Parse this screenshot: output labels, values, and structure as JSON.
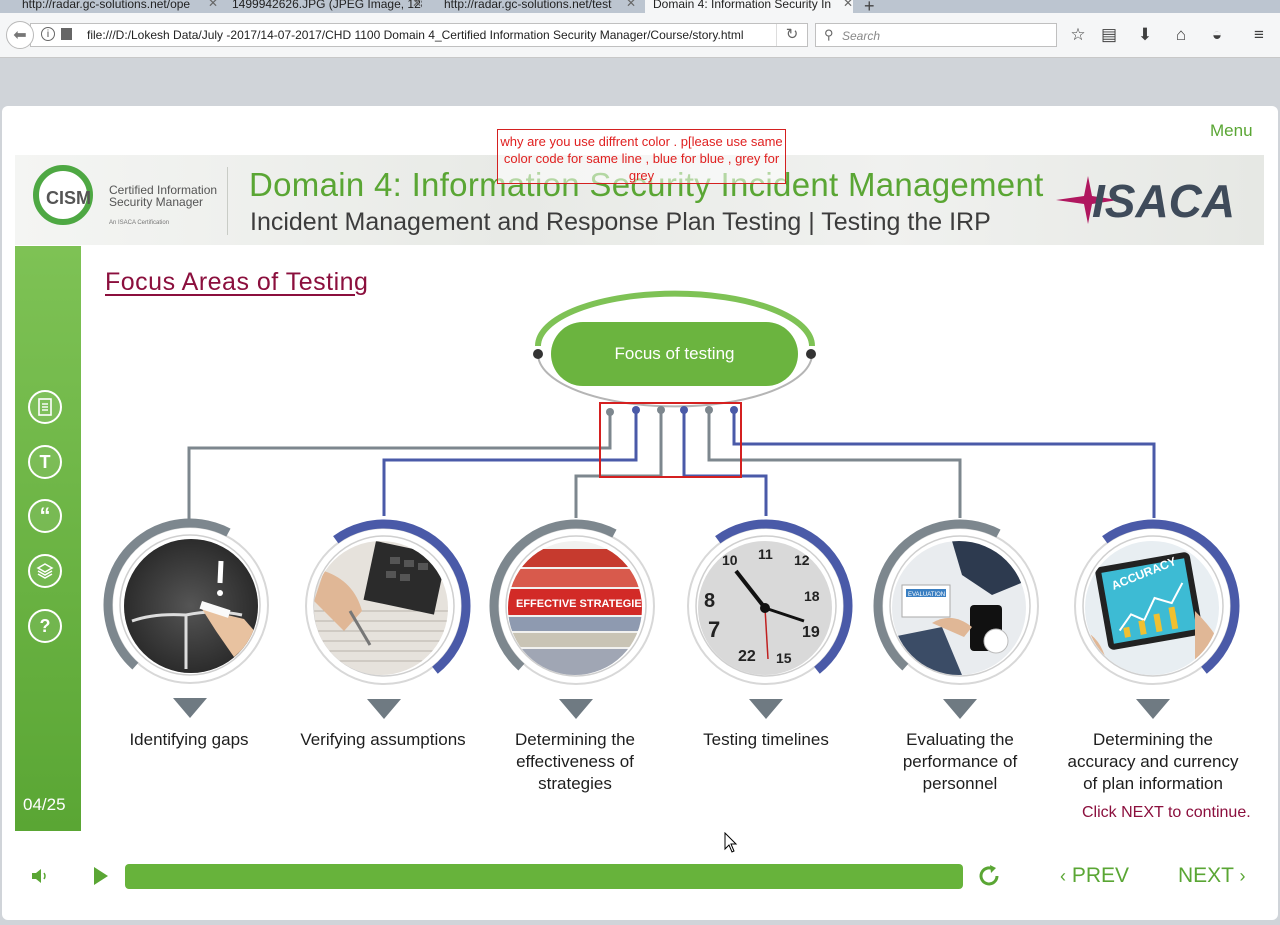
{
  "browser": {
    "tabs": [
      {
        "label": "http://radar.gc-solutions.net/ope",
        "active": false
      },
      {
        "label": "1499942626.JPG (JPEG Image, 128",
        "active": false
      },
      {
        "label": "http://radar.gc-solutions.net/test",
        "active": false
      },
      {
        "label": "Domain 4: Information Security In",
        "active": true
      }
    ],
    "url": "file:///D:/Lokesh Data/July -2017/14-07-2017/CHD 1100 Domain 4_Certified Information Security Manager/Course/story.html",
    "search_placeholder": "Search"
  },
  "course": {
    "menu_label": "Menu",
    "logo": {
      "acronym": "CISM",
      "line1": "Certified Information",
      "line2": "Security Manager",
      "tagline": "An ISACA Certification"
    },
    "partner_logo": "ISACA",
    "domain_title": "Domain 4: Information Security Incident Management",
    "subtitle": "Incident Management and Response Plan Testing | Testing the IRP",
    "review_note": "why are you use diffrent color . p[lease use same color code for same line , blue for blue , grey for grey",
    "heading": "Focus Areas of Testing",
    "center_label": "Focus of testing",
    "items": [
      {
        "label": "Identifying gaps",
        "line_color": "grey",
        "image": "chalkboard-photo"
      },
      {
        "label": "Verifying assumptions",
        "line_color": "blue",
        "image": "calculator-photo"
      },
      {
        "label": "Determining the effectiveness of strategies",
        "line_color": "grey",
        "image": "binders-photo",
        "image_text": "EFFECTIVE STRATEGIES"
      },
      {
        "label": "Testing timelines",
        "line_color": "blue",
        "image": "clock-photo"
      },
      {
        "label": "Evaluating the performance of personnel",
        "line_color": "grey",
        "image": "meeting-photo",
        "image_text": "EVALUATION"
      },
      {
        "label": "Determining the accuracy and currency of plan information",
        "line_color": "blue",
        "image": "tablet-photo",
        "image_text": "ACCURACY"
      }
    ],
    "click_next": "Click NEXT to continue.",
    "slide_counter": "04/25",
    "sidebar_icons": [
      "notes-icon",
      "transcript-icon",
      "quote-icon",
      "resources-icon",
      "help-icon"
    ]
  },
  "player": {
    "progress": 1.0,
    "prev_label": "PREV",
    "next_label": "NEXT"
  },
  "colors": {
    "green": "#5aa634",
    "blue": "#4a5aa8",
    "grey": "#7d878e",
    "maroon": "#8b0f3d",
    "note_red": "#e02020"
  }
}
